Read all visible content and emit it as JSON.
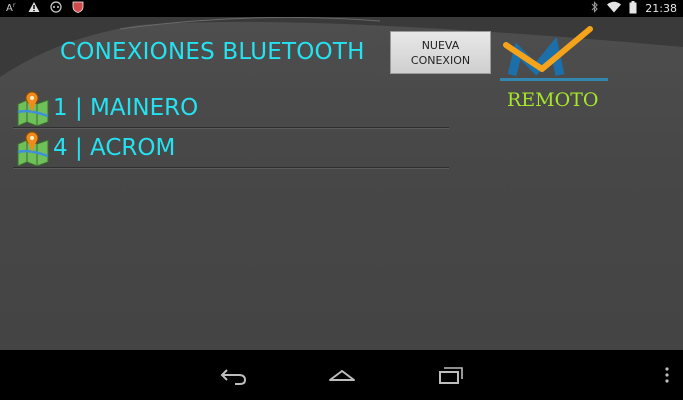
{
  "status_bar": {
    "left_icons": [
      "font-size-icon",
      "warning-icon",
      "gamepad-icon",
      "shield-icon"
    ],
    "right_icons": [
      "bluetooth-icon",
      "wifi-icon",
      "battery-icon"
    ],
    "time": "21:38"
  },
  "app": {
    "title": "CONEXIONES BLUETOOTH",
    "new_button": {
      "line1": "NUEVA",
      "line2": "CONEXION"
    },
    "logo_caption": "REMOTO",
    "connections": [
      {
        "label": "1 | MAINERO",
        "icon": "map-pin-icon"
      },
      {
        "label": "4 | ACROM",
        "icon": "map-pin-icon"
      }
    ]
  },
  "nav_bar": {
    "buttons": [
      "back-icon",
      "home-icon",
      "recent-apps-icon",
      "menu-icon"
    ]
  },
  "colors": {
    "accent": "#24e2f0",
    "logo_text": "#a6e62a",
    "logo_orange": "#f5a31a",
    "logo_blue": "#2a9fd8"
  }
}
